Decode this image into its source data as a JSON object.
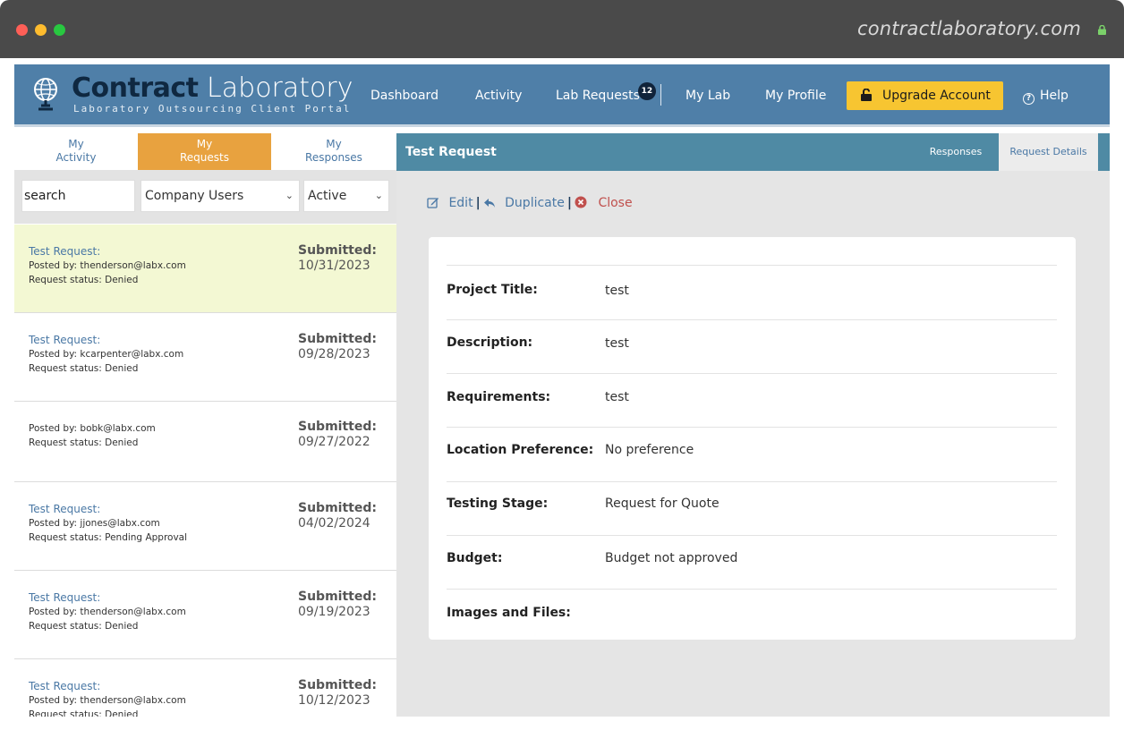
{
  "browser": {
    "url": "contractlaboratory.com"
  },
  "brand": {
    "title_bold": "Contract",
    "title_light": "Laboratory",
    "subtitle": "Laboratory Outsourcing Client Portal"
  },
  "nav": {
    "dashboard": "Dashboard",
    "activity": "Activity",
    "lab_requests": "Lab Requests",
    "lab_requests_badge": "12",
    "my_lab": "My Lab",
    "my_profile": "My Profile",
    "upgrade": "Upgrade Account",
    "help": "Help"
  },
  "left_tabs": {
    "activity_line1": "My",
    "activity_line2": "Activity",
    "requests_line1": "My",
    "requests_line2": "Requests",
    "responses_line1": "My",
    "responses_line2": "Responses"
  },
  "filters": {
    "search_value": "search",
    "users_value": "Company Users",
    "status_value": "Active"
  },
  "requests": [
    {
      "title": "Test Request:",
      "posted": "Posted by: thenderson@labx.com",
      "status": "Request status: Denied",
      "submitted": "Submitted:",
      "date": "10/31/2023"
    },
    {
      "title": "Test Request:",
      "posted": "Posted by: kcarpenter@labx.com",
      "status": "Request status: Denied",
      "submitted": "Submitted:",
      "date": "09/28/2023"
    },
    {
      "title": "",
      "posted": "Posted by: bobk@labx.com",
      "status": "Request status: Denied",
      "submitted": "Submitted:",
      "date": "09/27/2022"
    },
    {
      "title": "Test Request:",
      "posted": "Posted by: jjones@labx.com",
      "status": "Request status: Pending Approval",
      "submitted": "Submitted:",
      "date": "04/02/2024"
    },
    {
      "title": "Test Request:",
      "posted": "Posted by: thenderson@labx.com",
      "status": "Request status: Denied",
      "submitted": "Submitted:",
      "date": "09/19/2023"
    },
    {
      "title": "Test Request:",
      "posted": "Posted by: thenderson@labx.com",
      "status": "Request status: Denied",
      "submitted": "Submitted:",
      "date": "10/12/2023"
    }
  ],
  "detail": {
    "header_title": "Test Request",
    "tab_responses": "Responses",
    "tab_details": "Request Details",
    "action_edit": "Edit",
    "action_duplicate": "Duplicate",
    "action_close": "Close",
    "fields": [
      {
        "label": "Project Title:",
        "value": "test"
      },
      {
        "label": "Description:",
        "value": "test"
      },
      {
        "label": "Requirements:",
        "value": "test"
      },
      {
        "label": "Location Preference:",
        "value": "No preference"
      },
      {
        "label": "Testing Stage:",
        "value": "Request for Quote"
      },
      {
        "label": "Budget:",
        "value": "Budget not approved"
      },
      {
        "label": "Images and Files:",
        "value": ""
      }
    ]
  },
  "colors": {
    "header_blue": "#4f7fa8",
    "teal_bar": "#4f8aa4",
    "active_tab": "#e8a23f",
    "upgrade": "#f7c531",
    "selected_row": "#f3f8d3",
    "link_blue": "#4a78a5",
    "close_red": "#c0504d"
  }
}
